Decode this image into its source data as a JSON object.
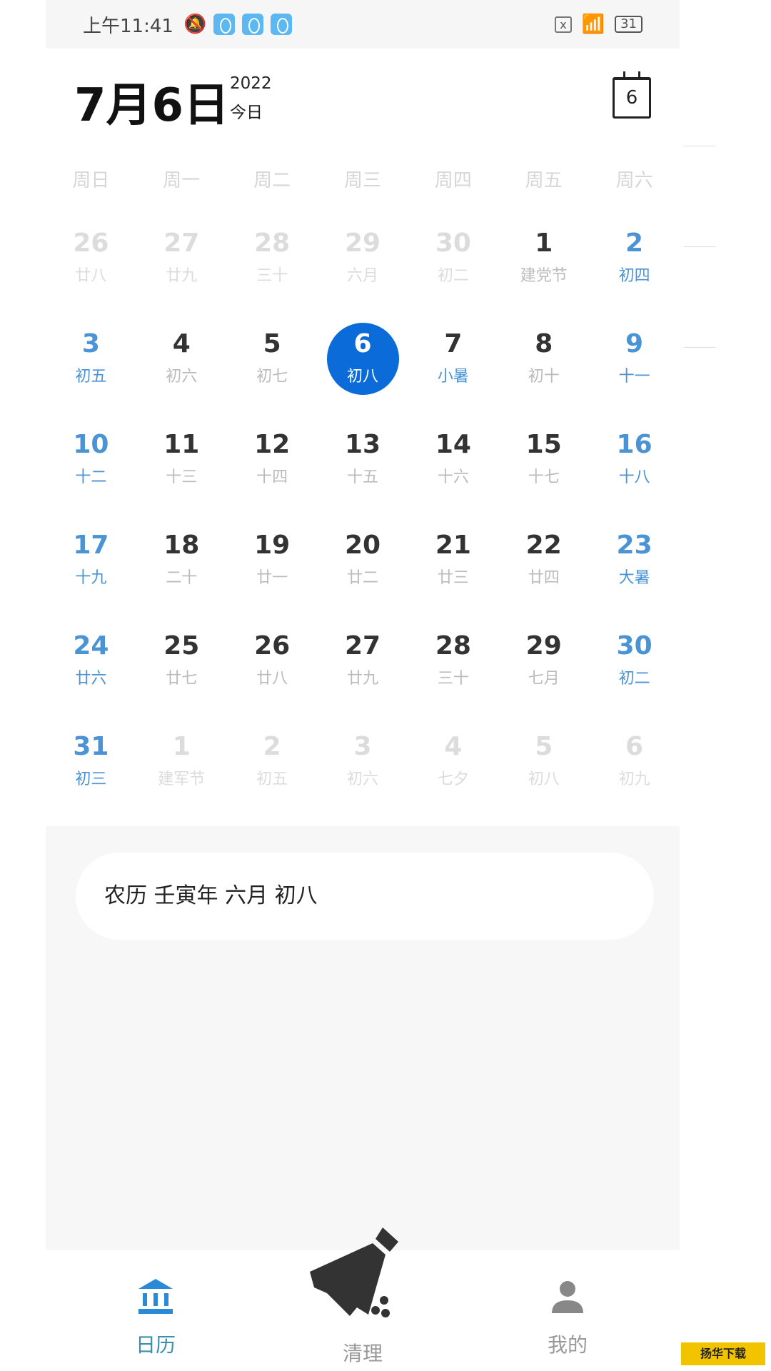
{
  "status_bar": {
    "time": "上午11:41",
    "battery": "31"
  },
  "header": {
    "date": "7月6日",
    "year": "2022",
    "today_label": "今日",
    "today_button": "6"
  },
  "weekdays": [
    "周日",
    "周一",
    "周二",
    "周三",
    "周四",
    "周五",
    "周六"
  ],
  "selected_day": "6",
  "weeks": [
    [
      {
        "d": "26",
        "l": "廿八",
        "o": 1
      },
      {
        "d": "27",
        "l": "廿九",
        "o": 1
      },
      {
        "d": "28",
        "l": "三十",
        "o": 1
      },
      {
        "d": "29",
        "l": "六月",
        "o": 1
      },
      {
        "d": "30",
        "l": "初二",
        "o": 1
      },
      {
        "d": "1",
        "l": "建党节"
      },
      {
        "d": "2",
        "l": "初四"
      }
    ],
    [
      {
        "d": "3",
        "l": "初五"
      },
      {
        "d": "4",
        "l": "初六"
      },
      {
        "d": "5",
        "l": "初七"
      },
      {
        "d": "6",
        "l": "初八",
        "s": 1
      },
      {
        "d": "7",
        "l": "小暑",
        "t": 1
      },
      {
        "d": "8",
        "l": "初十"
      },
      {
        "d": "9",
        "l": "十一"
      }
    ],
    [
      {
        "d": "10",
        "l": "十二"
      },
      {
        "d": "11",
        "l": "十三"
      },
      {
        "d": "12",
        "l": "十四"
      },
      {
        "d": "13",
        "l": "十五"
      },
      {
        "d": "14",
        "l": "十六"
      },
      {
        "d": "15",
        "l": "十七"
      },
      {
        "d": "16",
        "l": "十八"
      }
    ],
    [
      {
        "d": "17",
        "l": "十九"
      },
      {
        "d": "18",
        "l": "二十"
      },
      {
        "d": "19",
        "l": "廿一"
      },
      {
        "d": "20",
        "l": "廿二"
      },
      {
        "d": "21",
        "l": "廿三"
      },
      {
        "d": "22",
        "l": "廿四"
      },
      {
        "d": "23",
        "l": "大暑"
      }
    ],
    [
      {
        "d": "24",
        "l": "廿六"
      },
      {
        "d": "25",
        "l": "廿七"
      },
      {
        "d": "26",
        "l": "廿八"
      },
      {
        "d": "27",
        "l": "廿九"
      },
      {
        "d": "28",
        "l": "三十"
      },
      {
        "d": "29",
        "l": "七月"
      },
      {
        "d": "30",
        "l": "初二"
      }
    ],
    [
      {
        "d": "31",
        "l": "初三"
      },
      {
        "d": "1",
        "l": "建军节",
        "o": 1
      },
      {
        "d": "2",
        "l": "初五",
        "o": 1
      },
      {
        "d": "3",
        "l": "初六",
        "o": 1
      },
      {
        "d": "4",
        "l": "七夕",
        "o": 1
      },
      {
        "d": "5",
        "l": "初八",
        "o": 1
      },
      {
        "d": "6",
        "l": "初九",
        "o": 1
      }
    ]
  ],
  "lunar_info": "农历 壬寅年 六月 初八",
  "nav": {
    "calendar": "日历",
    "clean": "清理",
    "mine": "我的"
  },
  "colors": {
    "accent": "#0b6bd8",
    "weekend": "#4a93d4",
    "nav_active": "#2a8ad8"
  },
  "watermark": "扬华下载 YANGHUA.NET"
}
